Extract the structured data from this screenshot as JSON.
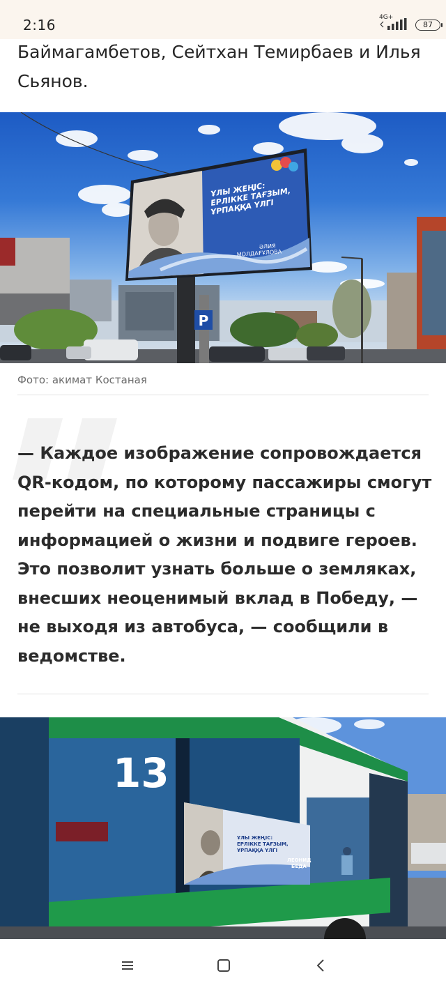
{
  "status_bar": {
    "time": "2:16",
    "network": "4G+",
    "battery": "87"
  },
  "article": {
    "lead_text": "Баймагамбетов, Сейтхан Темирбаев и Илья Сьянов.",
    "photo_1": {
      "caption": "Фото: акимат Костаная",
      "billboard_line_1": "ҰЛЫ ЖЕҢІС:",
      "billboard_line_2": "ЕРЛІККЕ ТАҒЗЫМ,",
      "billboard_line_3": "ҰРПАҚҚА ҮЛГІ",
      "billboard_name_1": "ӘЛИЯ",
      "billboard_name_2": "МОЛДАҒҰЛОВА",
      "parking_sign": "P"
    },
    "quote": "— Каждое изображение сопровождается QR-кодом, по которому пассажиры смогут перейти на специальные страницы с информацией о жизни и подвиге героев. Это позволит узнать больше о земляках, внесших неоценимый вклад в Победу, — не выходя из автобуса, — сообщили в ведомстве.",
    "photo_2": {
      "bus_number": "13",
      "poster_line_1": "ҰЛЫ ЖЕҢІС:",
      "poster_line_2": "ЕРЛІККЕ ТАҒЗЫМ,",
      "poster_line_3": "ҰРПАҚҚА ҮЛГІ",
      "poster_name_1": "ЛЕОНИД",
      "poster_name_2": "БЕДА"
    }
  },
  "nav_bar": {
    "icons": [
      "menu-icon",
      "home-icon",
      "back-icon"
    ]
  },
  "colors": {
    "status_bar_bg": "#fbf5ee",
    "text": "#262626",
    "caption": "#6c6c6c",
    "sky": "#2a6bd0",
    "billboard_blue": "#1f4fa8",
    "bus_green": "#1f9a4a"
  }
}
